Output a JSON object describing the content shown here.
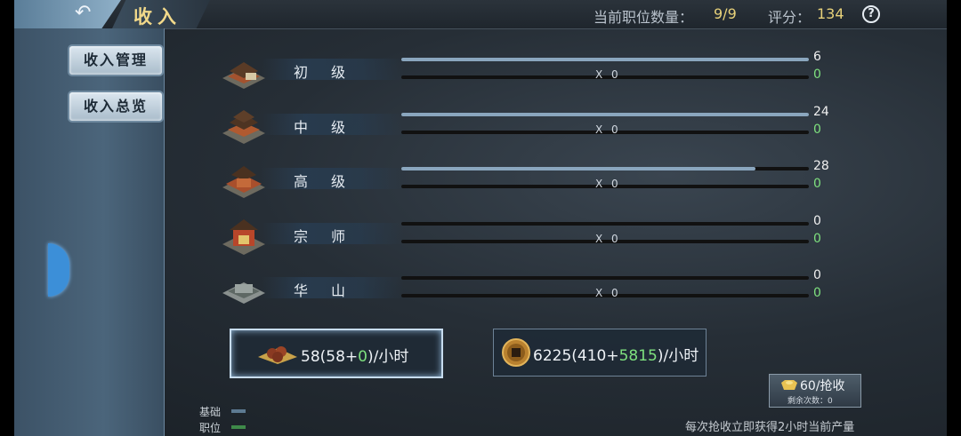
{
  "header": {
    "title": "收入",
    "positions_label": "当前职位数量：",
    "positions_value": "9/9",
    "score_label": "评分：",
    "score_value": "134",
    "help_glyph": "?"
  },
  "sidebar": {
    "items": [
      {
        "label": "收入管理"
      },
      {
        "label": "收入总览"
      }
    ]
  },
  "rows": [
    {
      "name": "初级",
      "base": "6",
      "position_bonus": "0",
      "multiplier": "X 0",
      "base_fill": 1.0
    },
    {
      "name": "中级",
      "base": "24",
      "position_bonus": "0",
      "multiplier": "X 0",
      "base_fill": 1.0
    },
    {
      "name": "高级",
      "base": "28",
      "position_bonus": "0",
      "multiplier": "X 0",
      "base_fill": 0.87
    },
    {
      "name": "宗师",
      "base": "0",
      "position_bonus": "0",
      "multiplier": "X 0",
      "base_fill": 0
    },
    {
      "name": "华山",
      "base": "0",
      "position_bonus": "0",
      "multiplier": "X 0",
      "base_fill": 0
    }
  ],
  "summary": {
    "food": {
      "total": "58",
      "base": "(58+",
      "bonus": "0",
      "suffix": ")/小时"
    },
    "coins": {
      "total": "6225",
      "base": "(410+",
      "bonus": "5815",
      "suffix": ")/小时"
    }
  },
  "harvest": {
    "label": "60/抢收",
    "remaining": "剩余次数：0"
  },
  "legend": {
    "base": "基础",
    "position": "职位",
    "base_color": "#5d7a92",
    "position_color": "#3f8a4a"
  },
  "footnote": "每次抢收立即获得2小时当前产量",
  "colors": {
    "accent_gold": "#f2d98a",
    "bonus_green": "#7ee07e"
  }
}
